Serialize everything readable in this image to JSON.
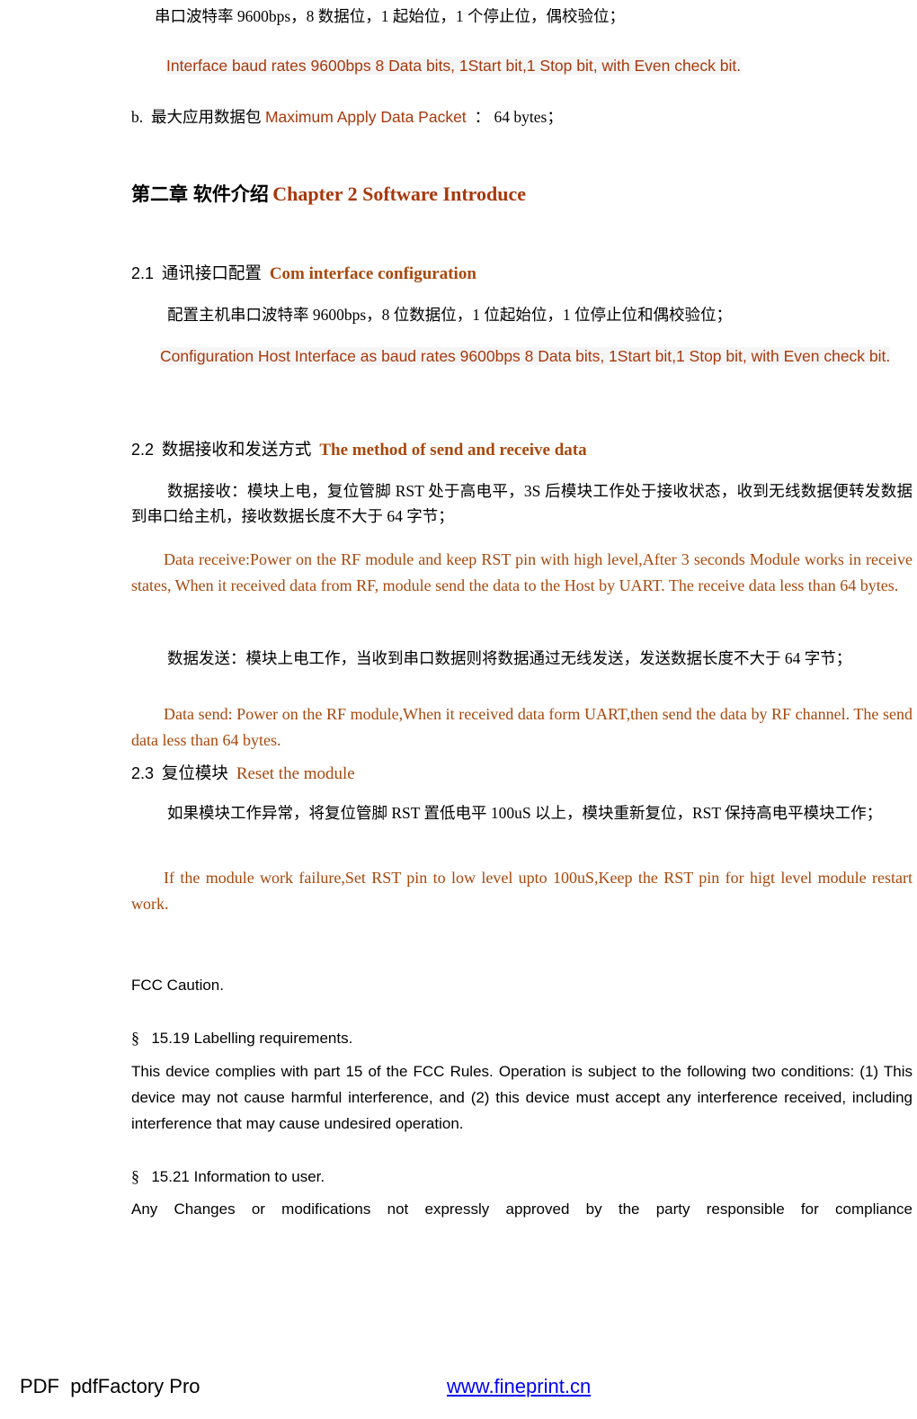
{
  "colors": {
    "accent_orange": "#A8480C",
    "accent_orange_sans": "#A8380C",
    "chapter_heading": "#A8380C",
    "link_blue": "#0000EE",
    "body_black": "#000000",
    "highlight_grey": "#f5f5f5"
  },
  "serial_spec": {
    "chinese": "串口波特率 9600bps，8 数据位，1 起始位，1 个停止位，偶校验位；",
    "english": "Interface baud rates 9600bps 8 Data bits, 1Start bit,1 Stop bit, with Even check bit."
  },
  "packet_item": {
    "bullet": "b.",
    "chinese": "最大应用数据包",
    "english": "Maximum Apply Data Packet",
    "separator": "：",
    "value": "64 bytes；"
  },
  "chapter": {
    "chinese": "第二章  软件介绍",
    "english": "Chapter 2 Software Introduce"
  },
  "section_21": {
    "number": "2.1",
    "chinese": "通讯接口配置",
    "english": "Com interface configuration",
    "body_cn": "配置主机串口波特率 9600bps，8 位数据位，1 位起始位，1 位停止位和偶校验位；",
    "body_en": "Configuration Host Interface as baud rates 9600bps 8 Data bits, 1Start bit,1 Stop bit, with Even check bit."
  },
  "section_22": {
    "number": "2.2",
    "chinese": "数据接收和发送方式",
    "english": "The method of send and receive data",
    "receive_cn": "数据接收：模块上电，复位管脚 RST  处于高电平，3S  后模块工作处于接收状态，收到无线数据便转发数据到串口给主机，接收数据长度不大于 64 字节；",
    "receive_en": "Data receive:Power on the RF module and keep RST pin with high level,After 3 seconds Module works in receive states, When it received data from RF, module send the data to the Host by UART. The receive data less than 64 bytes.",
    "send_cn": "数据发送：模块上电工作，当收到串口数据则将数据通过无线发送，发送数据长度不大于 64 字节；",
    "send_en": "Data send: Power on the RF module,When it received data form UART,then send the data by RF channel. The send data less than 64 bytes."
  },
  "section_23": {
    "number": "2.3",
    "chinese": "复位模块",
    "english": "Reset the module",
    "body_cn": "如果模块工作异常，将复位管脚 RST  置低电平 100uS  以上，模块重新复位，RST  保持高电平模块工作；",
    "body_en": "If the module work failure,Set RST pin to low level upto 100uS,Keep the RST pin for higt level module restart work."
  },
  "fcc": {
    "caution_title": "FCC Caution.",
    "section_symbol": "§",
    "item_1519_title": "15.19 Labelling requirements.",
    "item_1519_body": "This device complies with part 15 of the FCC Rules. Operation is subject to the following two conditions: (1) This device may not cause harmful interference, and (2) this device must accept any interference received, including interference that may cause undesired operation.",
    "item_1521_title": "15.21 Information to user.",
    "item_1521_body": "Any Changes or modifications not expressly approved by the party responsible for compliance"
  },
  "footer": {
    "left_text": "PDF  pdfFactory Pro",
    "link_text": "www.fineprint.cn"
  }
}
